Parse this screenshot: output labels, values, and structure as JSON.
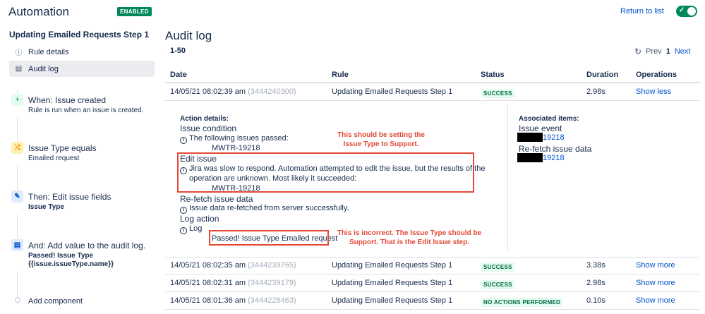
{
  "header": {
    "title": "Automation",
    "enabled_badge": "ENABLED",
    "return_link": "Return to list",
    "toggle_on": true
  },
  "sidebar": {
    "rule_name": "Updating Emailed Requests Step 1",
    "nav": [
      {
        "label": "Rule details",
        "icon": "info-icon"
      },
      {
        "label": "Audit log",
        "icon": "document-icon"
      }
    ],
    "components": [
      {
        "title": "When: Issue created",
        "sub": "Rule is run when an issue is created.",
        "icon": "plus-icon",
        "color": "#36b37e"
      },
      {
        "title": "Issue Type equals",
        "sub": "Emailed request",
        "icon": "shuffle-icon",
        "color": "#ffab00"
      },
      {
        "title": "Then: Edit issue fields",
        "sub": "Issue Type",
        "icon": "pencil-icon",
        "color": "#0052cc"
      },
      {
        "title": "And: Add value to the audit log.",
        "sub": "Passed! Issue Type",
        "sub2": "{{issue.issueType.name}}",
        "icon": "document-icon",
        "color": "#0052cc"
      }
    ],
    "add_component": "Add component"
  },
  "main": {
    "title": "Audit log",
    "range": "1-50",
    "pager": {
      "prev": "Prev",
      "page": "1",
      "next": "Next"
    },
    "columns": [
      "Date",
      "Rule",
      "Status",
      "Duration",
      "Operations"
    ],
    "rows": [
      {
        "date": "14/05/21 08:02:39 am",
        "id": "(3444240300)",
        "rule": "Updating Emailed Requests Step 1",
        "status": "SUCCESS",
        "duration": "2.98s",
        "op": "Show less"
      },
      {
        "date": "14/05/21 08:02:35 am",
        "id": "(3444239765)",
        "rule": "Updating Emailed Requests Step 1",
        "status": "SUCCESS",
        "duration": "3.38s",
        "op": "Show more"
      },
      {
        "date": "14/05/21 08:02:31 am",
        "id": "(3444239179)",
        "rule": "Updating Emailed Requests Step 1",
        "status": "SUCCESS",
        "duration": "2.98s",
        "op": "Show more"
      },
      {
        "date": "14/05/21 08:01:36 am",
        "id": "(3444228463)",
        "rule": "Updating Emailed Requests Step 1",
        "status": "NO ACTIONS PERFORMED",
        "duration": "0.10s",
        "op": "Show more"
      }
    ],
    "details": {
      "heading": "Action details:",
      "issue_condition": "Issue condition",
      "issue_condition_msg": "The following issues passed:",
      "issue_key": "MWTR-19218",
      "edit_issue": "Edit issue",
      "edit_issue_msg1": "Jira was slow to respond. Automation attempted to edit the issue, but the results of the",
      "edit_issue_msg2": "operation are unknown. Most likely it succeeded:",
      "edit_issue_key": "MWTR-19218",
      "refetch": "Re-fetch issue data",
      "refetch_msg": "Issue data re-fetched from server successfully.",
      "log_action": "Log action",
      "log_label": "Log",
      "log_value": "Passed! Issue Type Emailed request",
      "associated_heading": "Associated items:",
      "issue_event": "Issue event",
      "issue_event_link": "19218",
      "refetch_item": "Re-fetch issue data",
      "refetch_link": "19218"
    },
    "annotations": {
      "note1_line1": "This should be setting the",
      "note1_line2": "Issue Type to Support.",
      "note2_line1": "This is incorrect. The Issue Type should be",
      "note2_line2": "Support. That is the Edit Issue step."
    }
  },
  "colors": {
    "accent": "#0052cc",
    "enabled": "#00875a",
    "success_bg": "#e3fcef",
    "success_text": "#006644",
    "annotation_red": "#e34935"
  }
}
